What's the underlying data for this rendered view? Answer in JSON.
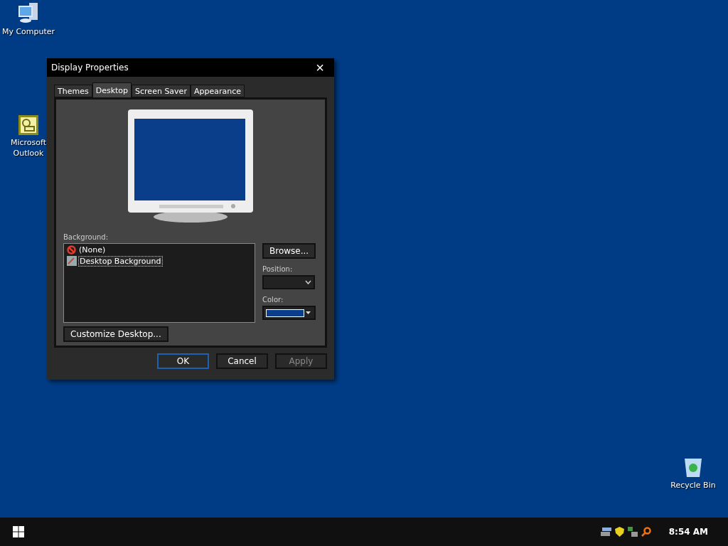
{
  "desktop_icons": [
    {
      "kind": "computer",
      "label": "My Computer"
    },
    {
      "kind": "outlook",
      "label": "Microsoft Outlook"
    },
    {
      "kind": "recycle",
      "label": "Recycle Bin"
    }
  ],
  "window": {
    "title": "Display Properties",
    "close": "×",
    "tabs": [
      {
        "label": "Themes",
        "selected": false
      },
      {
        "label": "Desktop",
        "selected": true
      },
      {
        "label": "Screen Saver",
        "selected": false
      },
      {
        "label": "Appearance",
        "selected": false
      }
    ],
    "background_label": "Background:",
    "background_items": [
      {
        "kind": "none",
        "label": "(None)",
        "selected": false
      },
      {
        "kind": "image",
        "label": "Desktop Background",
        "selected": true
      }
    ],
    "browse_button": "Browse...",
    "position_label": "Position:",
    "color_label": "Color:",
    "color": "#0a3d8a",
    "customize_button": "Customize Desktop...",
    "buttons": [
      {
        "label": "OK",
        "default": true,
        "disabled": false
      },
      {
        "label": "Cancel",
        "default": false,
        "disabled": false
      },
      {
        "label": "Apply",
        "default": false,
        "disabled": true
      }
    ]
  },
  "taskbar": {
    "clock": "8:54 AM"
  }
}
